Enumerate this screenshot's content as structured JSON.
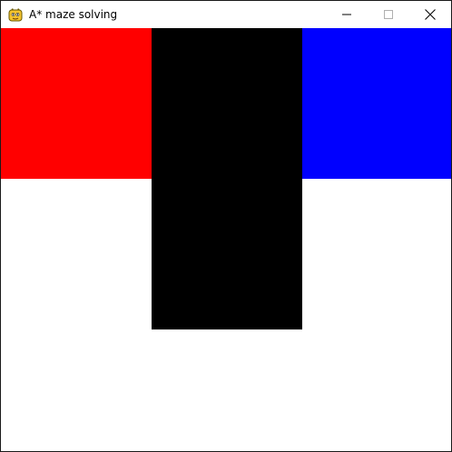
{
  "window": {
    "title": "A* maze solving",
    "app_icon": "pygame-snake-icon",
    "controls": [
      "minimize-icon",
      "maximize-icon",
      "close-icon"
    ]
  },
  "maze": {
    "grid_size": 3,
    "cells": [
      {
        "row": 0,
        "col": 0,
        "kind": "start",
        "color": "#ff0000"
      },
      {
        "row": 0,
        "col": 1,
        "kind": "wall",
        "color": "#000000"
      },
      {
        "row": 0,
        "col": 2,
        "kind": "goal",
        "color": "#0000ff"
      },
      {
        "row": 1,
        "col": 1,
        "kind": "wall",
        "color": "#000000"
      }
    ],
    "empty_color": "#ffffff"
  }
}
